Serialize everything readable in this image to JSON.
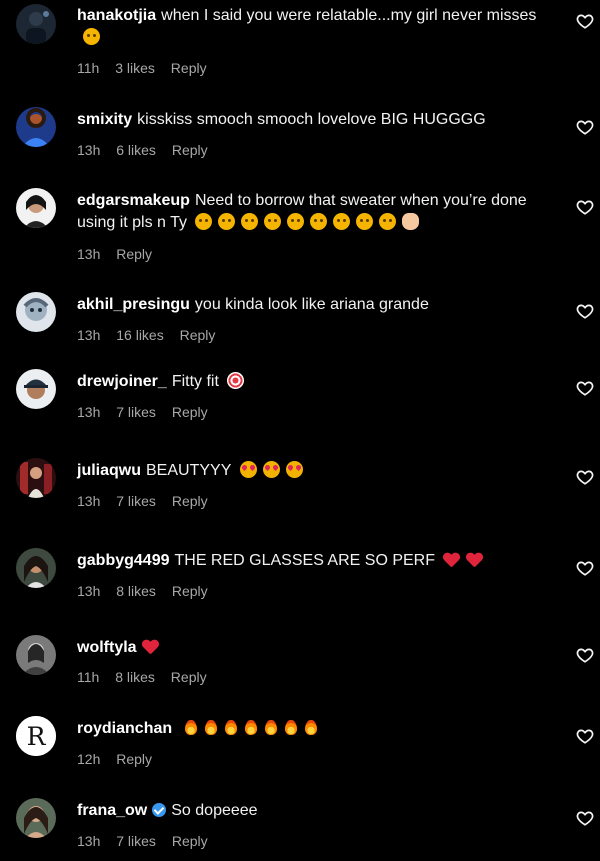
{
  "icons": {
    "like": "heart-outline-icon",
    "verified": "verified-badge-icon"
  },
  "colors": {
    "background": "#000000",
    "username": "#ffffff",
    "meta": "#a8a8a8",
    "verified": "#3897f0"
  },
  "comments": [
    {
      "username": "hanakotjia",
      "text": "when I said you were relatable...my girl never misses",
      "time": "11h",
      "likes": "3 likes",
      "reply": "Reply",
      "avatar": "avatar-hanakotjia"
    },
    {
      "username": "smixity",
      "text": "kisskiss smooch smooch lovelove BIG HUGGGG",
      "time": "13h",
      "likes": "6 likes",
      "reply": "Reply",
      "avatar": "avatar-smixity"
    },
    {
      "username": "edgarsmakeup",
      "text": "Need to borrow that sweater when you’re done using it pls n Ty",
      "time": "13h",
      "likes": "",
      "reply": "Reply",
      "avatar": "avatar-edgarsmakeup"
    },
    {
      "username": "akhil_presingu",
      "text": "you kinda look like ariana grande",
      "time": "13h",
      "likes": "16 likes",
      "reply": "Reply",
      "avatar": "avatar-akhil"
    },
    {
      "username": "drewjoiner_",
      "text": "Fitty fit",
      "time": "13h",
      "likes": "7 likes",
      "reply": "Reply",
      "avatar": "avatar-drewjoiner"
    },
    {
      "username": "juliaqwu",
      "text": "BEAUTYYY",
      "time": "13h",
      "likes": "7 likes",
      "reply": "Reply",
      "avatar": "avatar-juliaqwu"
    },
    {
      "username": "gabbyg4499",
      "text": "THE RED GLASSES ARE SO PERF",
      "time": "13h",
      "likes": "8 likes",
      "reply": "Reply",
      "avatar": "avatar-gabbyg"
    },
    {
      "username": "wolftyla",
      "text": "",
      "time": "11h",
      "likes": "8 likes",
      "reply": "Reply",
      "avatar": "avatar-wolftyla"
    },
    {
      "username": "roydianchan",
      "text": "",
      "time": "12h",
      "likes": "",
      "reply": "Reply",
      "avatar": "avatar-roydianchan"
    },
    {
      "username": "frana_ow",
      "text": "So dopeeee",
      "time": "13h",
      "likes": "7 likes",
      "reply": "Reply",
      "avatar": "avatar-frana"
    }
  ]
}
